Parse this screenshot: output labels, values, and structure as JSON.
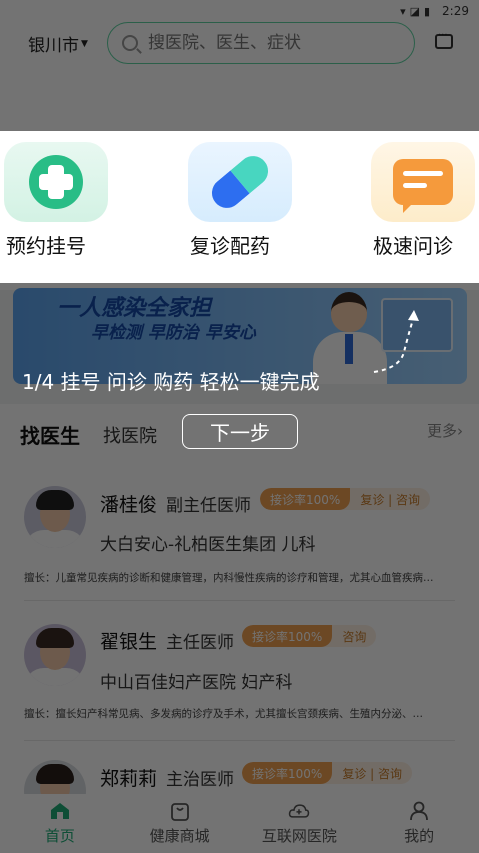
{
  "status_bar": {
    "time": "2:29",
    "icons": [
      "wifi-icon",
      "signal-icon",
      "battery-icon"
    ]
  },
  "header": {
    "city": "银川市",
    "search_placeholder": "搜医院、医生、症状"
  },
  "banner": {
    "slogan_line1": "一人感染全家担",
    "slogan_line2": "早检测 早防治 早安心"
  },
  "quick_actions": [
    {
      "label": "预约挂号",
      "icon": "hospital-cross-icon"
    },
    {
      "label": "复诊配药",
      "icon": "pill-capsule-icon"
    },
    {
      "label": "极速问诊",
      "icon": "chat-bubble-icon"
    }
  ],
  "guide": {
    "step_text": "1/4 挂号 问诊 购药 轻松一键完成",
    "next_label": "下一步"
  },
  "tabs": {
    "active": "找医生",
    "other": "找医院",
    "more": "更多›"
  },
  "doctors": [
    {
      "name": "潘桂俊",
      "title": "副主任医师",
      "rate": "接诊率100%",
      "ops": "复诊 | 咨询",
      "hospital": "大白安心-礼柏医生集团 儿科",
      "specialty": "擅长：儿童常见疾病的诊断和健康管理，内科慢性疾病的诊疗和管理，尤其心血管疾病…"
    },
    {
      "name": "翟银生",
      "title": "主任医师",
      "rate": "接诊率100%",
      "ops": "咨询",
      "hospital": "中山百佳妇产医院 妇产科",
      "specialty": "擅长：擅长妇产科常见病、多发病的诊疗及手术，尤其擅长宫颈疾病、生殖内分泌、…"
    },
    {
      "name": "郑莉莉",
      "title": "主治医师",
      "rate": "接诊率100%",
      "ops": "复诊 | 咨询"
    }
  ],
  "bottom_nav": [
    {
      "label": "首页",
      "icon": "home-icon",
      "active": true
    },
    {
      "label": "健康商城",
      "icon": "shopping-bag-icon",
      "active": false
    },
    {
      "label": "互联网医院",
      "icon": "cloud-hospital-icon",
      "active": false
    },
    {
      "label": "我的",
      "icon": "user-icon",
      "active": false
    }
  ],
  "colors": {
    "accent": "#28bd86",
    "overlay": "rgba(0,0,0,0.55)",
    "badge": "#f0a050"
  }
}
